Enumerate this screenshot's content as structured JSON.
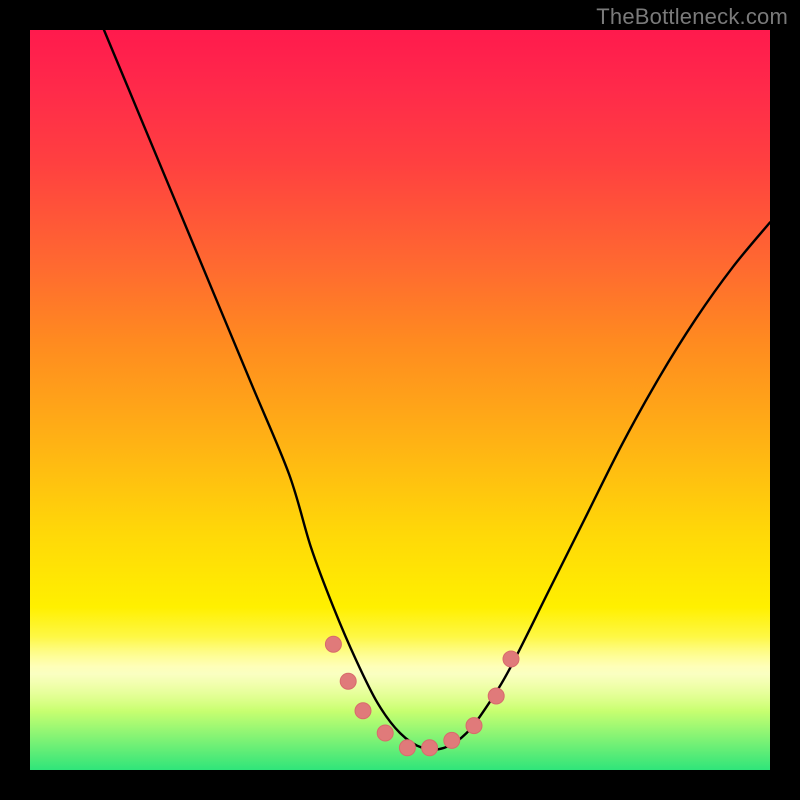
{
  "watermark": {
    "text": "TheBottleneck.com"
  },
  "colors": {
    "frame": "#000000",
    "curve_stroke": "#000000",
    "marker_fill": "#e07a7a",
    "marker_stroke": "#d86b6b",
    "gradient_stops": [
      "#ff1a4d",
      "#ff4040",
      "#ff8a20",
      "#ffd808",
      "#fff000",
      "#fdff8a",
      "#2fe57a"
    ]
  },
  "chart_data": {
    "type": "line",
    "title": "",
    "xlabel": "",
    "ylabel": "",
    "xlim": [
      0,
      100
    ],
    "ylim": [
      0,
      100
    ],
    "note": "Axes are unlabeled in the image; values are estimated from pixel positions on a 0–100 normalized scale (y inverted: 0 at top, 100 at bottom).",
    "series": [
      {
        "name": "bottleneck-curve",
        "x": [
          10,
          15,
          20,
          25,
          30,
          35,
          38,
          41,
          44,
          47,
          50,
          53,
          56,
          59,
          62,
          65,
          70,
          75,
          80,
          85,
          90,
          95,
          100
        ],
        "y": [
          0,
          12,
          24,
          36,
          48,
          60,
          70,
          78,
          85,
          91,
          95,
          97,
          97,
          95,
          91,
          86,
          76,
          66,
          56,
          47,
          39,
          32,
          26
        ]
      }
    ],
    "markers": {
      "name": "highlight-points",
      "x": [
        41,
        43,
        45,
        48,
        51,
        54,
        57,
        60,
        63,
        65
      ],
      "y": [
        83,
        88,
        92,
        95,
        97,
        97,
        96,
        94,
        90,
        85
      ]
    }
  }
}
